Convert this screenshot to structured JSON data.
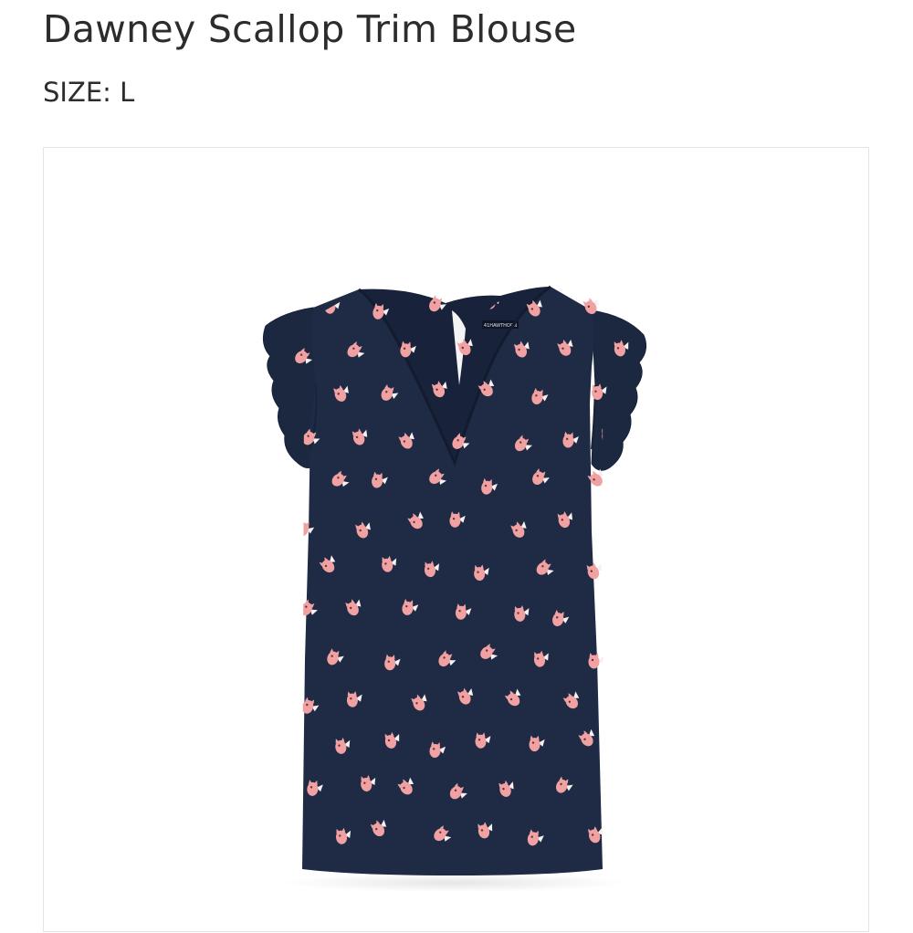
{
  "product": {
    "title": "Dawney Scallop Trim Blouse",
    "size_label": "SIZE:",
    "size_value": "L",
    "brand_tag_text": "41HAWTHORN"
  },
  "colors": {
    "fabric": "#1f2b45",
    "print": "#f2a1a3",
    "print_accent": "#f7f0ee",
    "text": "#2c2c2c",
    "card_border": "#e4e4e4"
  }
}
